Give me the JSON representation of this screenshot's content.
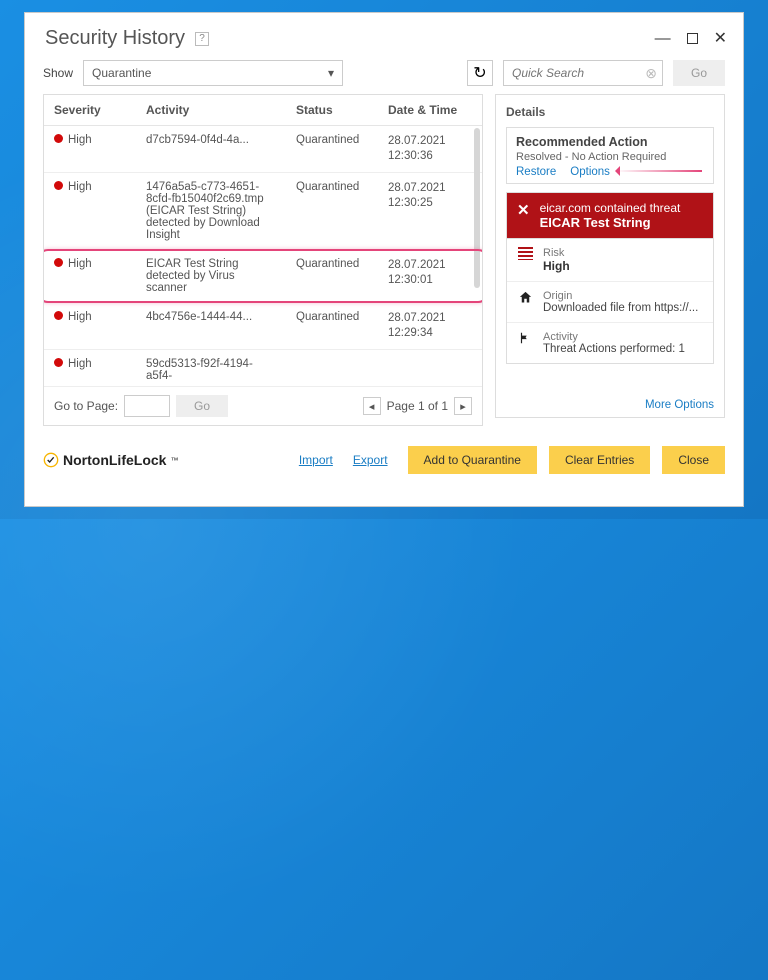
{
  "window": {
    "title": "Security History",
    "help": "?"
  },
  "filter": {
    "show_label": "Show",
    "dropdown_value": "Quarantine",
    "search_placeholder": "Quick Search",
    "go_label": "Go"
  },
  "table": {
    "headers": {
      "severity": "Severity",
      "activity": "Activity",
      "status": "Status",
      "datetime": "Date & Time"
    },
    "rows": [
      {
        "severity": "High",
        "activity": "d7cb7594-0f4d-4a...",
        "status": "Quarantined",
        "date": "28.07.2021",
        "time": "12:30:36",
        "selected": false
      },
      {
        "severity": "High",
        "activity": "1476a5a5-c773-4651-8cfd-fb15040f2c69.tmp (EICAR Test String) detected by Download Insight",
        "status": "Quarantined",
        "date": "28.07.2021",
        "time": "12:30:25",
        "selected": false
      },
      {
        "severity": "High",
        "activity": "EICAR Test String detected by Virus scanner",
        "status": "Quarantined",
        "date": "28.07.2021",
        "time": "12:30:01",
        "selected": true
      },
      {
        "severity": "High",
        "activity": "4bc4756e-1444-44...",
        "status": "Quarantined",
        "date": "28.07.2021",
        "time": "12:29:34",
        "selected": false
      },
      {
        "severity": "High",
        "activity": "59cd5313-f92f-4194-a5f4-",
        "status": "",
        "date": "",
        "time": "",
        "selected": false
      }
    ]
  },
  "pager": {
    "goto_label": "Go to Page:",
    "go_label": "Go",
    "status": "Page 1 of 1"
  },
  "details": {
    "panel_title": "Details",
    "recommended": {
      "title": "Recommended Action",
      "subtitle": "Resolved - No Action Required",
      "restore": "Restore",
      "options": "Options"
    },
    "threat": {
      "line1": "eicar.com contained threat",
      "name": "EICAR Test String"
    },
    "items": {
      "risk_label": "Risk",
      "risk_value": "High",
      "origin_label": "Origin",
      "origin_value": "Downloaded file from https://...",
      "activity_label": "Activity",
      "activity_value": "Threat Actions performed: 1"
    },
    "more_options": "More Options"
  },
  "footer": {
    "brand": "NortonLifeLock",
    "import": "Import",
    "export": "Export",
    "add_btn": "Add to Quarantine",
    "clear_btn": "Clear Entries",
    "close_btn": "Close"
  }
}
